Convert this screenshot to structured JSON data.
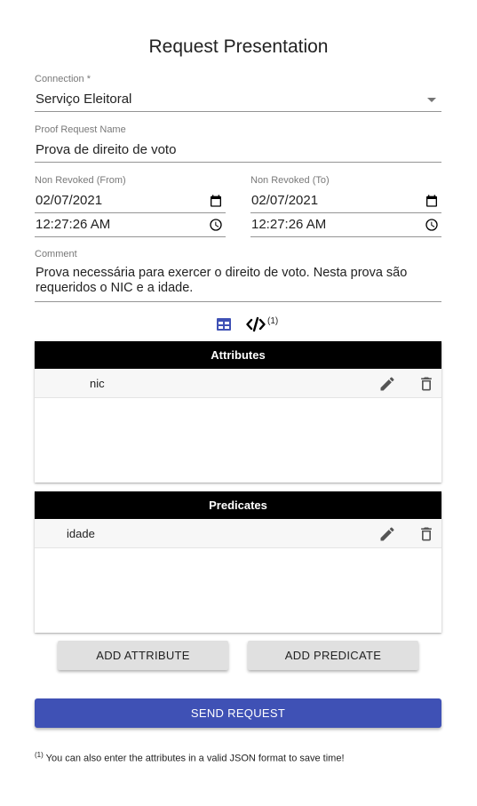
{
  "page": {
    "title": "Request Presentation"
  },
  "connection": {
    "label": "Connection *",
    "value": "Serviço Eleitoral"
  },
  "proof_request_name": {
    "label": "Proof Request Name",
    "value": "Prova de direito de voto"
  },
  "non_revoked_from": {
    "label": "Non Revoked (From)",
    "date": "02/07/2021",
    "time": "12:27:26 AM"
  },
  "non_revoked_to": {
    "label": "Non Revoked (To)",
    "date": "02/07/2021",
    "time": "12:27:26 AM"
  },
  "comment": {
    "label": "Comment",
    "value": "Prova necessária para exercer o direito de voto. Nesta prova são requeridos o NIC e a idade."
  },
  "view_toggle": {
    "json_note": "(1)",
    "active": "table"
  },
  "attributes": {
    "header": "Attributes",
    "items": [
      {
        "name": "nic"
      }
    ]
  },
  "predicates": {
    "header": "Predicates",
    "items": [
      {
        "name": "idade"
      }
    ]
  },
  "buttons": {
    "add_attribute": "ADD ATTRIBUTE",
    "add_predicate": "ADD PREDICATE",
    "send_request": "SEND REQUEST"
  },
  "footnote": {
    "marker": "(1)",
    "text": " You can also enter the attributes in a valid JSON format to save time!"
  },
  "colors": {
    "primary": "#3f51b5",
    "table_header": "#000000",
    "button_grey": "#e0e0e0"
  }
}
